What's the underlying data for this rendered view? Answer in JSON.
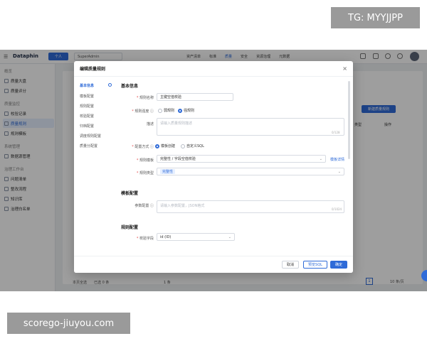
{
  "watermarks": {
    "top_right": "TG: MYYJJPP",
    "bottom_left": "scorego-jiuyou.com"
  },
  "app": {
    "logo": "Dataphin",
    "project": "个人",
    "tenant": "SuperAdmin",
    "nav_tabs": [
      "资产清单",
      "标准",
      "质量",
      "安全",
      "资源治理",
      "元数据"
    ]
  },
  "sidebar": {
    "items": [
      {
        "label": "概览",
        "group": true
      },
      {
        "label": "质量大盘"
      },
      {
        "label": "质量评分"
      },
      {
        "label": "质量监控",
        "group": true
      },
      {
        "label": "校验记录"
      },
      {
        "label": "质量规则",
        "active": true
      },
      {
        "label": "规则模板"
      },
      {
        "label": "系统管理",
        "group": true
      },
      {
        "label": "数据源管理"
      },
      {
        "label": "治理工作台",
        "group": true
      },
      {
        "label": "问题清单"
      },
      {
        "label": "整改流程"
      },
      {
        "label": "知识库"
      },
      {
        "label": "治理白名单"
      }
    ]
  },
  "background": {
    "new_rule_button": "新建质量规则",
    "ops_header": "操作",
    "type_header": "类型",
    "footer_left": "本页全选",
    "footer_selected": "已选 0 条",
    "footer_total": "1 条",
    "footer_page": "1",
    "footer_size": "10 条/页"
  },
  "modal": {
    "title": "编辑质量规则",
    "left_nav": [
      "基本信息",
      "模板配置",
      "规则配置",
      "校验配置",
      "归档配置",
      "调度规则配置",
      "质量分配置"
    ],
    "basic_section": "基本信息",
    "fields": {
      "rule_name_label": "规则名称",
      "rule_name_value": "主键空值校验",
      "rule_strength_label": "规则强度",
      "weak_rule": "弱规则",
      "strong_rule": "强规则",
      "desc_label": "描述",
      "desc_placeholder": "请输入质量规则描述",
      "desc_counter": "0/128",
      "config_mode_label": "配置方式",
      "by_template": "模板创建",
      "custom_sql": "自定义SQL",
      "rule_template_label": "规则模板",
      "rule_template_value": "完整性 / 字段空值校验",
      "template_detail_link": "模板详情",
      "rule_type_label": "规则类型",
      "rule_type_tag": "完整性"
    },
    "template_section": "模板配置",
    "param_label": "参数配置",
    "param_placeholder": "请输入参数配置，JSON格式",
    "param_counter": "0/1024",
    "rule_section": "规则配置",
    "check_field_label": "校验字段",
    "check_field_value": "id (ID)",
    "buttons": {
      "cancel": "取消",
      "validate": "预览SQL",
      "ok": "确定"
    }
  },
  "colors": {
    "primary": "#2f6bd8",
    "overlay": "rgba(0,0,0,0.38)"
  }
}
